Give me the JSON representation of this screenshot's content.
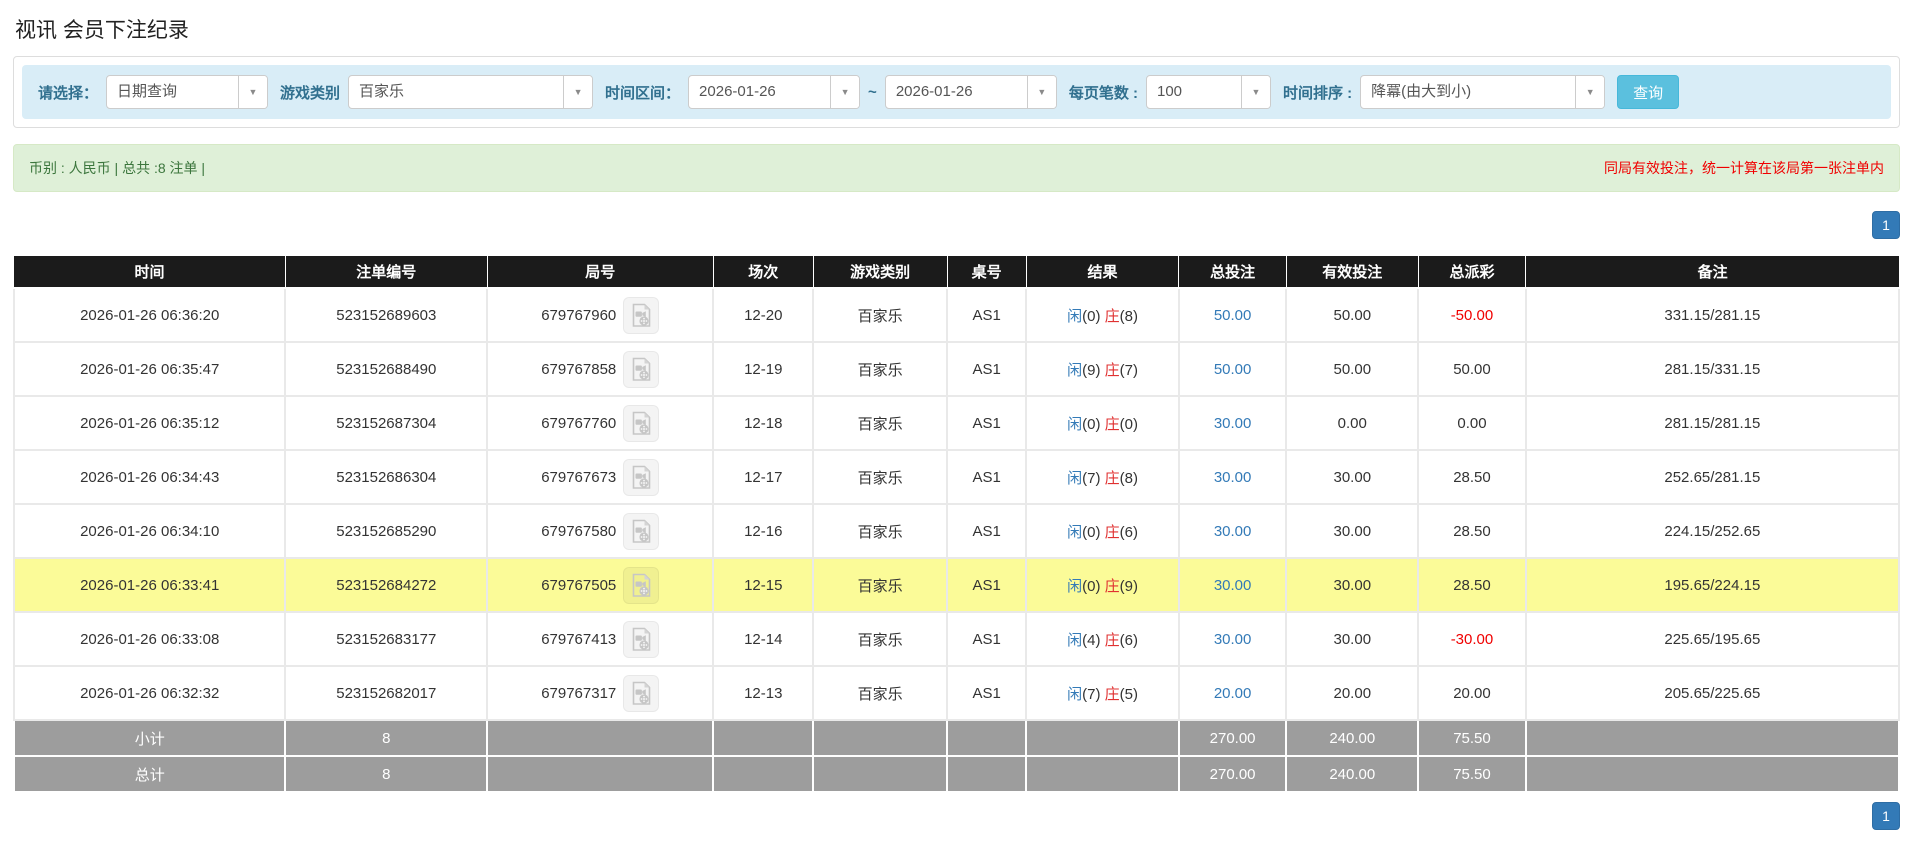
{
  "page": {
    "title": "视讯 会员下注纪录"
  },
  "filters": {
    "select_label": "请选择：",
    "select_value": "日期查询",
    "game_label": "游戏类别",
    "game_value": "百家乐",
    "range_label": "时间区间：",
    "date_from": "2026-01-26",
    "tilde": "~",
    "date_to": "2026-01-26",
    "per_page_label": "每页笔数 :",
    "per_page_value": "100",
    "sort_label": "时间排序 :",
    "sort_value": "降冪(由大到小)",
    "query_button": "查询",
    "caret_glyph": "▼"
  },
  "summary": {
    "left": "币别 : 人民币 | 总共 :8 注单 |",
    "right": "同局有效投注，统一计算在该局第一张注单内"
  },
  "pagination": {
    "page": "1"
  },
  "colors": {
    "accent_blue": "#337ab7",
    "query_button_blue": "#5bc0de",
    "player_blue": "#337ab7",
    "banker_red": "#e03131",
    "negative_red": "#f00000",
    "highlight_yellow": "#fbfb98",
    "header_black": "#1b1b1b",
    "footer_gray": "#9d9d9d",
    "summary_green_bg": "#dff0d8",
    "summary_green_text": "#3c763d",
    "filter_bar_blue": "#d9edf7"
  },
  "table": {
    "headers": [
      "时间",
      "注单编号",
      "局号",
      "场次",
      "游戏类别",
      "桌号",
      "结果",
      "总投注",
      "有效投注",
      "总派彩",
      "备注"
    ],
    "rows": [
      {
        "time": "2026-01-26 06:36:20",
        "bet_id": "523152689603",
        "round_id": "679767960",
        "session": "12-20",
        "game": "百家乐",
        "table_no": "AS1",
        "p_label": "闲",
        "p_val": "(0)",
        "b_label": "庄",
        "b_val": "(8)",
        "total_bet": "50.00",
        "valid_bet": "50.00",
        "payout": "-50.00",
        "note": "331.15/281.15",
        "highlight": false
      },
      {
        "time": "2026-01-26 06:35:47",
        "bet_id": "523152688490",
        "round_id": "679767858",
        "session": "12-19",
        "game": "百家乐",
        "table_no": "AS1",
        "p_label": "闲",
        "p_val": "(9)",
        "b_label": "庄",
        "b_val": "(7)",
        "total_bet": "50.00",
        "valid_bet": "50.00",
        "payout": "50.00",
        "note": "281.15/331.15",
        "highlight": false
      },
      {
        "time": "2026-01-26 06:35:12",
        "bet_id": "523152687304",
        "round_id": "679767760",
        "session": "12-18",
        "game": "百家乐",
        "table_no": "AS1",
        "p_label": "闲",
        "p_val": "(0)",
        "b_label": "庄",
        "b_val": "(0)",
        "total_bet": "30.00",
        "valid_bet": "0.00",
        "payout": "0.00",
        "note": "281.15/281.15",
        "highlight": false
      },
      {
        "time": "2026-01-26 06:34:43",
        "bet_id": "523152686304",
        "round_id": "679767673",
        "session": "12-17",
        "game": "百家乐",
        "table_no": "AS1",
        "p_label": "闲",
        "p_val": "(7)",
        "b_label": "庄",
        "b_val": "(8)",
        "total_bet": "30.00",
        "valid_bet": "30.00",
        "payout": "28.50",
        "note": "252.65/281.15",
        "highlight": false
      },
      {
        "time": "2026-01-26 06:34:10",
        "bet_id": "523152685290",
        "round_id": "679767580",
        "session": "12-16",
        "game": "百家乐",
        "table_no": "AS1",
        "p_label": "闲",
        "p_val": "(0)",
        "b_label": "庄",
        "b_val": "(6)",
        "total_bet": "30.00",
        "valid_bet": "30.00",
        "payout": "28.50",
        "note": "224.15/252.65",
        "highlight": false
      },
      {
        "time": "2026-01-26 06:33:41",
        "bet_id": "523152684272",
        "round_id": "679767505",
        "session": "12-15",
        "game": "百家乐",
        "table_no": "AS1",
        "p_label": "闲",
        "p_val": "(0)",
        "b_label": "庄",
        "b_val": "(9)",
        "total_bet": "30.00",
        "valid_bet": "30.00",
        "payout": "28.50",
        "note": "195.65/224.15",
        "highlight": true
      },
      {
        "time": "2026-01-26 06:33:08",
        "bet_id": "523152683177",
        "round_id": "679767413",
        "session": "12-14",
        "game": "百家乐",
        "table_no": "AS1",
        "p_label": "闲",
        "p_val": "(4)",
        "b_label": "庄",
        "b_val": "(6)",
        "total_bet": "30.00",
        "valid_bet": "30.00",
        "payout": "-30.00",
        "note": "225.65/195.65",
        "highlight": false
      },
      {
        "time": "2026-01-26 06:32:32",
        "bet_id": "523152682017",
        "round_id": "679767317",
        "session": "12-13",
        "game": "百家乐",
        "table_no": "AS1",
        "p_label": "闲",
        "p_val": "(7)",
        "b_label": "庄",
        "b_val": "(5)",
        "total_bet": "20.00",
        "valid_bet": "20.00",
        "payout": "20.00",
        "note": "205.65/225.65",
        "highlight": false
      }
    ],
    "footer": [
      {
        "label": "小计",
        "count": "8",
        "total_bet": "270.00",
        "valid_bet": "240.00",
        "payout": "75.50"
      },
      {
        "label": "总计",
        "count": "8",
        "total_bet": "270.00",
        "valid_bet": "240.00",
        "payout": "75.50"
      }
    ]
  }
}
